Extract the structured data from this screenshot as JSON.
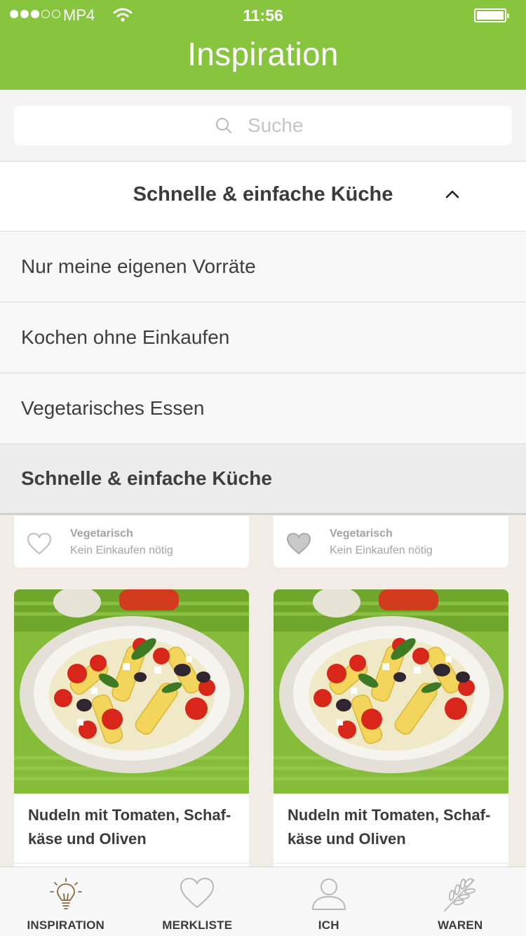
{
  "status_bar": {
    "carrier": "MP4",
    "time": "11:56",
    "signal_full": 3,
    "signal_total": 5
  },
  "header": {
    "title": "Inspiration"
  },
  "search": {
    "placeholder": "Suche",
    "value": ""
  },
  "dropdown": {
    "selected_label": "Schnelle & einfache Küche",
    "expanded": true,
    "options": [
      {
        "label": "Nur meine eigenen Vorräte",
        "selected": false
      },
      {
        "label": "Kochen ohne Einkaufen",
        "selected": false
      },
      {
        "label": "Vegetarisches Essen",
        "selected": false
      },
      {
        "label": "Schnelle & einfache Küche",
        "selected": true
      }
    ]
  },
  "cards_top": [
    {
      "tag": "Vegetarisch",
      "note": "Kein Einkaufen nötig",
      "favorited": false
    },
    {
      "tag": "Vegetarisch",
      "note": "Kein Einkaufen nötig",
      "favorited": true
    }
  ],
  "recipes": [
    {
      "title": "Nudeln mit Tomaten, Schaf-käse und Oliven"
    },
    {
      "title": "Nudeln mit Tomaten, Schaf-käse und Oliven"
    }
  ],
  "tabbar": {
    "active_color": "#8a6a45",
    "items": [
      {
        "label": "INSPIRATION",
        "icon": "lightbulb-icon",
        "active": true
      },
      {
        "label": "MERKLISTE",
        "icon": "heart-icon",
        "active": false
      },
      {
        "label": "ICH",
        "icon": "person-icon",
        "active": false
      },
      {
        "label": "WAREN",
        "icon": "wheat-icon",
        "active": false
      }
    ]
  },
  "colors": {
    "brand_green": "#87c53f",
    "background": "#f1ece5"
  }
}
